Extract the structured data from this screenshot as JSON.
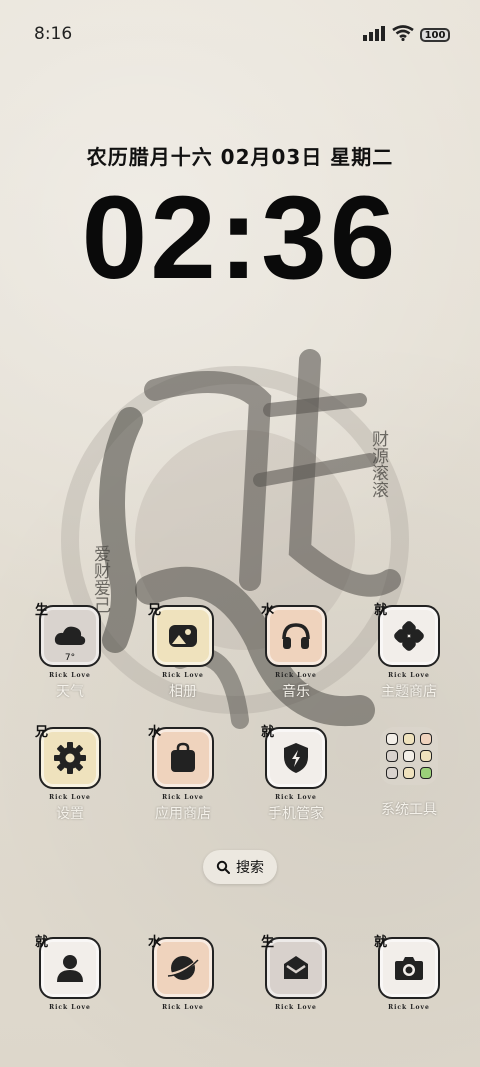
{
  "status_bar": {
    "time": "8:16",
    "battery": "100"
  },
  "lockscreen": {
    "date_line": "农历腊月十六  02月03日  星期二",
    "clock": "02:36"
  },
  "colors": {
    "tile_beige": "#efe2bd",
    "tile_peach": "#efd3bd",
    "tile_light": "#f2eeea",
    "tile_gray": "#d8d1cc"
  },
  "calligraphy": {
    "side_right": "财源滚滚",
    "side_left": "爱财爱己"
  },
  "apps": [
    {
      "label": "天气",
      "badge": "生",
      "icon": "cloud-icon",
      "temp": "7°"
    },
    {
      "label": "相册",
      "badge": "兄",
      "icon": "photo-icon"
    },
    {
      "label": "音乐",
      "badge": "水",
      "icon": "headphones-icon"
    },
    {
      "label": "主题商店",
      "badge": "就",
      "icon": "clover-icon"
    },
    {
      "label": "设置",
      "badge": "兄",
      "icon": "gear-icon"
    },
    {
      "label": "应用商店",
      "badge": "水",
      "icon": "bag-icon"
    },
    {
      "label": "手机管家",
      "badge": "就",
      "icon": "shield-icon"
    },
    {
      "label": "系统工具",
      "icon": "folder-icon"
    }
  ],
  "tile_caption": "Rick  Love",
  "search": {
    "label": "搜索"
  },
  "dock": [
    {
      "badge": "就",
      "icon": "contacts-icon"
    },
    {
      "badge": "水",
      "icon": "browser-icon"
    },
    {
      "badge": "生",
      "icon": "messages-icon"
    },
    {
      "badge": "就",
      "icon": "camera-icon"
    }
  ]
}
